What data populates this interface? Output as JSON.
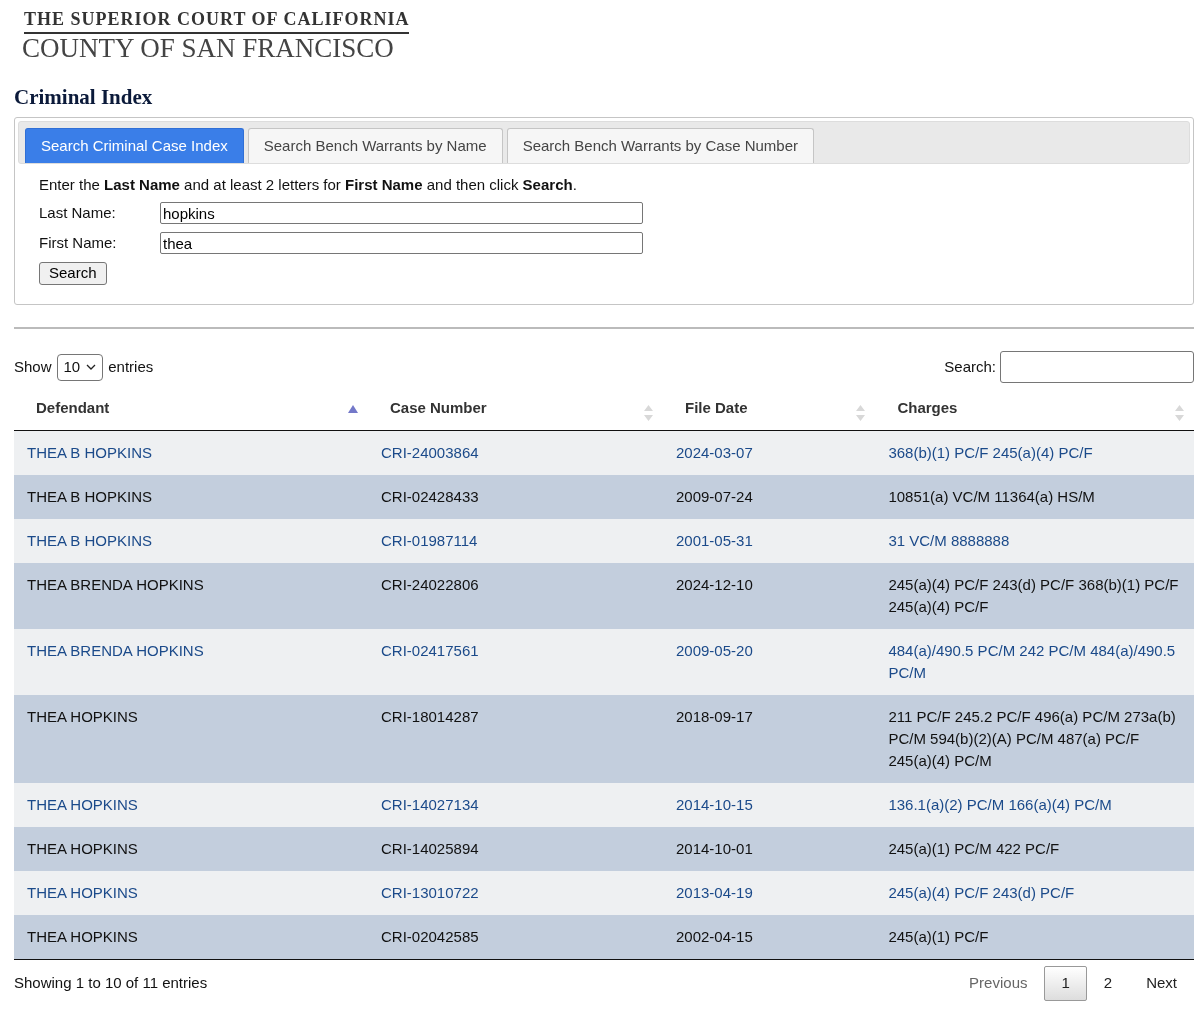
{
  "header": {
    "logo_line_1": "THE SUPERIOR COURT OF CALIFORNIA",
    "logo_line_2": "COUNTY OF SAN FRANCISCO"
  },
  "page_title": "Criminal Index",
  "tabs": [
    {
      "label": "Search Criminal Case Index",
      "selected": true
    },
    {
      "label": "Search Bench Warrants by Name",
      "selected": false
    },
    {
      "label": "Search Bench Warrants by Case Number",
      "selected": false
    }
  ],
  "search_form": {
    "instructions": "Enter the **Last Name** and at least 2 letters for **First Name** and then click **Search**.",
    "fields": [
      {
        "label": "Last Name:",
        "value": "hopkins"
      },
      {
        "label": "First Name:",
        "value": "thea"
      }
    ],
    "button": "Search"
  },
  "table_controls": {
    "show_label": "Show",
    "page_size": "10",
    "entries_label": "entries",
    "search_label": "Search:"
  },
  "table": {
    "columns": [
      {
        "label": "Defendant",
        "sorted": true
      },
      {
        "label": "Case Number",
        "sorted": false
      },
      {
        "label": "File Date",
        "sorted": false
      },
      {
        "label": "Charges",
        "sorted": false
      }
    ],
    "rows": [
      {
        "shaded": false,
        "cells": [
          "THEA B HOPKINS",
          "CRI-24003864",
          "2024-03-07",
          "368(b)(1) PC/F 245(a)(4) PC/F"
        ]
      },
      {
        "shaded": true,
        "cells": [
          "THEA B HOPKINS",
          "CRI-02428433",
          "2009-07-24",
          "10851(a) VC/M 11364(a) HS/M"
        ]
      },
      {
        "shaded": false,
        "cells": [
          "THEA B HOPKINS",
          "CRI-01987114",
          "2001-05-31",
          "31 VC/M 8888888"
        ]
      },
      {
        "shaded": true,
        "cells": [
          "THEA BRENDA HOPKINS",
          "CRI-24022806",
          "2024-12-10",
          "245(a)(4) PC/F 243(d) PC/F 368(b)(1) PC/F 245(a)(4) PC/F"
        ]
      },
      {
        "shaded": false,
        "cells": [
          "THEA BRENDA HOPKINS",
          "CRI-02417561",
          "2009-05-20",
          "484(a)/490.5 PC/M 242 PC/M 484(a)/490.5 PC/M"
        ]
      },
      {
        "shaded": true,
        "cells": [
          "THEA HOPKINS",
          "CRI-18014287",
          "2018-09-17",
          "211 PC/F 245.2 PC/F 496(a) PC/M 273a(b) PC/M 594(b)(2)(A) PC/M 487(a) PC/F 245(a)(4) PC/M"
        ]
      },
      {
        "shaded": false,
        "cells": [
          "THEA HOPKINS",
          "CRI-14027134",
          "2014-10-15",
          "136.1(a)(2) PC/M 166(a)(4) PC/M"
        ]
      },
      {
        "shaded": true,
        "cells": [
          "THEA HOPKINS",
          "CRI-14025894",
          "2014-10-01",
          "245(a)(1) PC/M 422 PC/F"
        ]
      },
      {
        "shaded": false,
        "cells": [
          "THEA HOPKINS",
          "CRI-13010722",
          "2013-04-19",
          "245(a)(4) PC/F 243(d) PC/F"
        ]
      },
      {
        "shaded": true,
        "cells": [
          "THEA HOPKINS",
          "CRI-02042585",
          "2002-04-15",
          "245(a)(1) PC/F"
        ]
      }
    ]
  },
  "footer": {
    "info": "Showing 1 to 10 of 11 entries",
    "pagination": [
      {
        "label": "Previous",
        "disabled": true,
        "selected": false
      },
      {
        "label": "1",
        "disabled": false,
        "selected": true
      },
      {
        "label": "2",
        "disabled": false,
        "selected": false
      },
      {
        "label": "Next",
        "disabled": false,
        "selected": false
      }
    ]
  }
}
